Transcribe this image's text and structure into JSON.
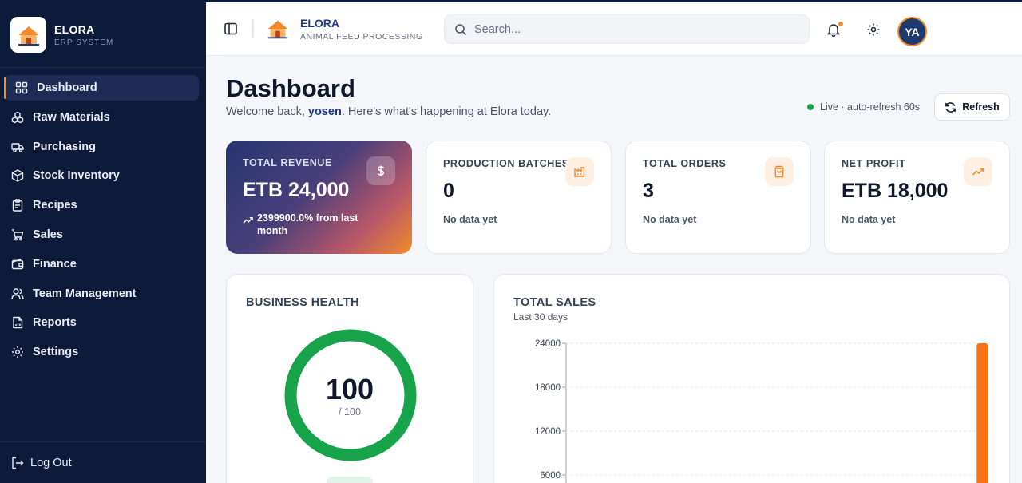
{
  "sidebar": {
    "brand_name": "ELORA",
    "brand_sub": "ERP SYSTEM",
    "items": [
      {
        "label": "Dashboard",
        "icon": "grid-icon",
        "active": true
      },
      {
        "label": "Raw Materials",
        "icon": "boxes-icon"
      },
      {
        "label": "Purchasing",
        "icon": "truck-icon"
      },
      {
        "label": "Stock Inventory",
        "icon": "package-icon"
      },
      {
        "label": "Recipes",
        "icon": "clipboard-icon"
      },
      {
        "label": "Sales",
        "icon": "cart-icon"
      },
      {
        "label": "Finance",
        "icon": "wallet-icon"
      },
      {
        "label": "Team Management",
        "icon": "users-icon"
      },
      {
        "label": "Reports",
        "icon": "report-icon"
      },
      {
        "label": "Settings",
        "icon": "gear-icon"
      }
    ],
    "logout_label": "Log Out"
  },
  "header": {
    "brand_name": "ELORA",
    "brand_sub": "ANIMAL FEED PROCESSING",
    "search_placeholder": "Search...",
    "avatar_initials": "YA"
  },
  "page": {
    "title": "Dashboard",
    "welcome_prefix": "Welcome back, ",
    "user": "yosen",
    "welcome_suffix": ". Here's what's happening at Elora today.",
    "live_status": "Live · auto-refresh 60s",
    "refresh_label": "Refresh"
  },
  "cards": {
    "revenue": {
      "label": "TOTAL REVENUE",
      "value": "ETB 24,000",
      "trend": "2399900.0% from last month",
      "icon": "dollar-icon"
    },
    "batches": {
      "label": "PRODUCTION BATCHES",
      "value": "0",
      "sub": "No data yet",
      "icon": "factory-icon"
    },
    "orders": {
      "label": "TOTAL ORDERS",
      "value": "3",
      "sub": "No data yet",
      "icon": "bag-icon"
    },
    "profit": {
      "label": "NET PROFIT",
      "value": "ETB 18,000",
      "sub": "No data yet",
      "icon": "trending-up-icon"
    }
  },
  "health": {
    "title": "BUSINESS HEALTH",
    "score": "100",
    "max_label": "/ 100",
    "fraction": 1.0
  },
  "sales": {
    "title": "TOTAL SALES",
    "subtitle": "Last 30 days"
  },
  "chart_data": {
    "type": "bar",
    "title": "TOTAL SALES",
    "subtitle": "Last 30 days",
    "yticks": [
      24000,
      18000,
      12000,
      6000
    ],
    "ylim": [
      0,
      24000
    ],
    "x_count": 30,
    "values": [
      0,
      0,
      0,
      0,
      0,
      0,
      0,
      0,
      0,
      0,
      0,
      0,
      0,
      0,
      0,
      0,
      0,
      0,
      0,
      0,
      0,
      0,
      0,
      0,
      0,
      0,
      0,
      0,
      0,
      24000
    ],
    "color": "#f97316",
    "grid": true
  },
  "colors": {
    "sidebar_bg": "#0d1a3a",
    "accent": "#f28a2a",
    "health_green": "#16a34a",
    "bar_orange": "#f97316"
  }
}
